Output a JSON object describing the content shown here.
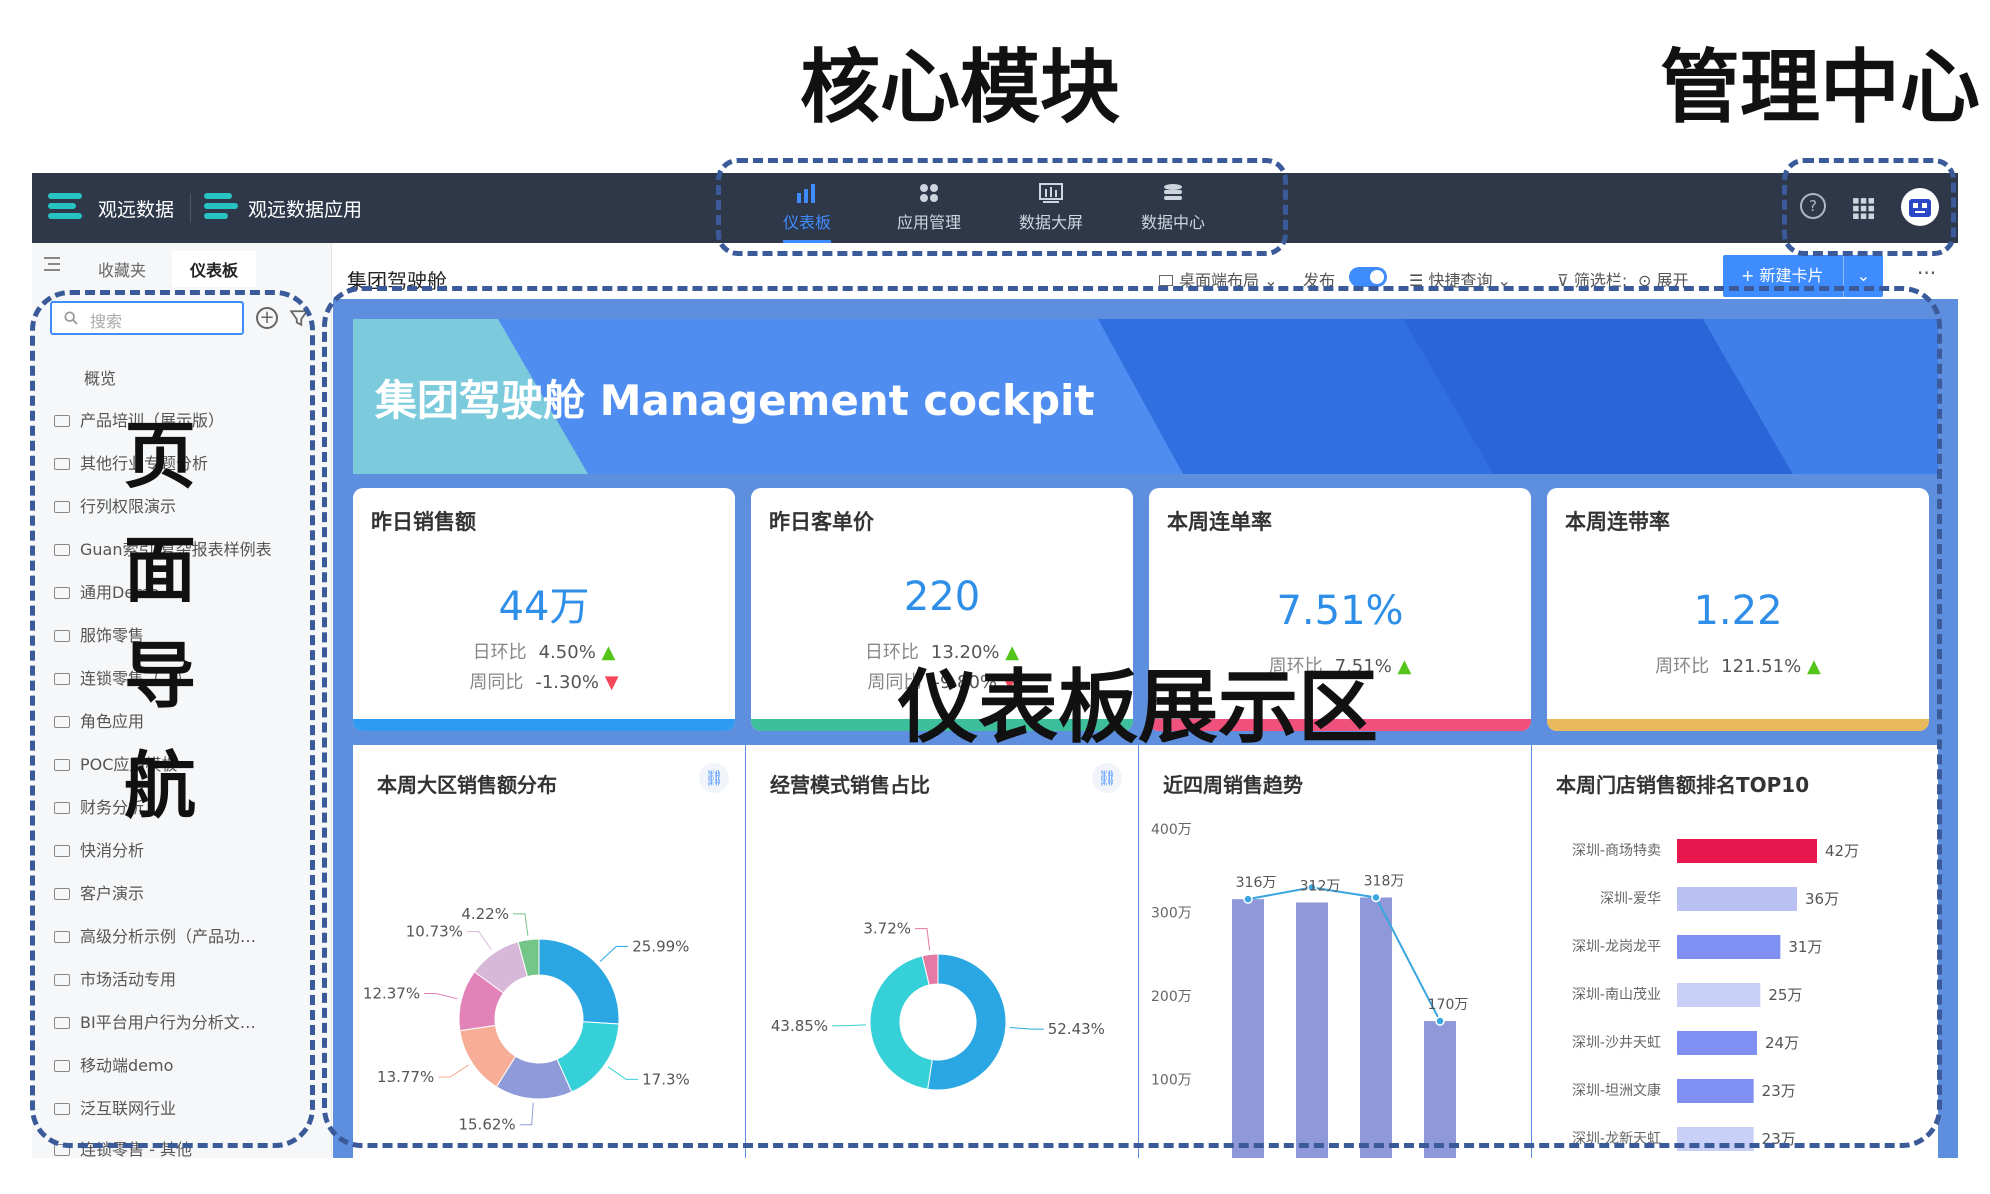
{
  "callouts": {
    "core": "核心模块",
    "admin": "管理中心",
    "nav": [
      "页",
      "面",
      "导",
      "航"
    ],
    "dashboard": "仪表板展示区"
  },
  "topbar": {
    "brand": "观远数据",
    "app_name": "观远数据应用",
    "nav": [
      {
        "label": "仪表板",
        "icon": "bar-chart-icon",
        "active": true
      },
      {
        "label": "应用管理",
        "icon": "apps-icon",
        "active": false
      },
      {
        "label": "数据大屏",
        "icon": "screen-icon",
        "active": false
      },
      {
        "label": "数据中心",
        "icon": "database-icon",
        "active": false
      }
    ],
    "help": "?"
  },
  "sidebar": {
    "tabs": [
      "收藏夹",
      "仪表板"
    ],
    "search_placeholder": "搜索",
    "items": [
      "概览",
      "产品培训（展示版）",
      "其他行业专题分析",
      "行列权限演示",
      "Guan索引·复杂报表样例表",
      "通用Demo",
      "服饰零售",
      "连锁零售（…）",
      "角色应用",
      "POC应用模板",
      "财务分析",
      "快消分析",
      "客户演示",
      "高级分析示例（产品功…",
      "市场活动专用",
      "BI平台用户行为分析文…",
      "移动端demo",
      "泛互联网行业",
      "连锁零售 - 其他"
    ]
  },
  "toolbar": {
    "title": "集团驾驶舱",
    "layout": "桌面端布局",
    "publish": "发布",
    "quick_query": "快捷查询",
    "filter": "筛选栏:",
    "expand": "展开",
    "new_card": "+ 新建卡片",
    "more": "···"
  },
  "banner": {
    "title": "集团驾驶舱 Management cockpit"
  },
  "kpis": [
    {
      "title": "昨日销售额",
      "value": "44万",
      "rows": [
        {
          "label": "日环比",
          "value": "4.50%",
          "dir": "▲"
        },
        {
          "label": "周同比",
          "value": "-1.30%",
          "dir": "▼"
        }
      ],
      "color": "#2f9bf0"
    },
    {
      "title": "昨日客单价",
      "value": "220",
      "rows": [
        {
          "label": "日环比",
          "value": "13.20%",
          "dir": "▲"
        },
        {
          "label": "周同比",
          "value": "-9.80%",
          "dir": "▼"
        }
      ],
      "color": "#3ebf9b"
    },
    {
      "title": "本周连单率",
      "value": "7.51%",
      "rows": [
        {
          "label": "周环比",
          "value": "7.51%",
          "dir": "▲"
        }
      ],
      "color": "#f0507c"
    },
    {
      "title": "本周连带率",
      "value": "1.22",
      "rows": [
        {
          "label": "周环比",
          "value": "121.51%",
          "dir": "▲"
        }
      ],
      "color": "#e9b95d"
    }
  ],
  "panels": {
    "region": "本周大区销售额分布",
    "mode": "经营模式销售占比",
    "trend": "近四周销售趋势",
    "top10": "本周门店销售额排名TOP10"
  },
  "chart_data": [
    {
      "type": "pie",
      "title": "本周大区销售额分布",
      "labels": [
        "25.99%",
        "17.3%",
        "15.62%",
        "13.77%",
        "12.37%",
        "10.73%",
        "4.22%"
      ],
      "values": [
        25.99,
        17.3,
        15.62,
        13.77,
        12.37,
        10.73,
        4.22
      ],
      "colors": [
        "#2aa7e2",
        "#36d0d8",
        "#8f9ad9",
        "#f7ad96",
        "#e282b8",
        "#d7b8d9",
        "#74c588"
      ]
    },
    {
      "type": "pie",
      "title": "经营模式销售占比",
      "labels": [
        "52.43%",
        "43.85%",
        "3.72%"
      ],
      "values": [
        52.43,
        43.85,
        3.72
      ],
      "colors": [
        "#2aa7e2",
        "#36d0d8",
        "#e57aa5"
      ]
    },
    {
      "type": "bar",
      "title": "近四周销售趋势",
      "y_ticks": [
        "400万",
        "300万",
        "200万",
        "100万"
      ],
      "ylim": [
        0,
        400
      ],
      "values": [
        316,
        312,
        318,
        170
      ],
      "labels": [
        "316万",
        "312万",
        "318万",
        "170万"
      ],
      "line_values": [
        316,
        330,
        318,
        170
      ]
    },
    {
      "type": "bar",
      "title": "本周门店销售额排名TOP10",
      "categories": [
        "深圳-商场特卖",
        "深圳-爱华",
        "深圳-龙岗龙平",
        "深圳-南山茂业",
        "深圳-沙井天虹",
        "深圳-坦洲文康",
        "深圳-龙新天虹"
      ],
      "values": [
        42,
        36,
        31,
        25,
        24,
        23,
        23
      ],
      "labels": [
        "42万",
        "36万",
        "31万",
        "25万",
        "24万",
        "23万",
        "23万"
      ],
      "colors": [
        "#e8174d",
        "#b9c1f3",
        "#7f8ff2",
        "#c8d0f7",
        "#7f8ff2",
        "#7f8ff2",
        "#c8d0f7"
      ]
    }
  ]
}
